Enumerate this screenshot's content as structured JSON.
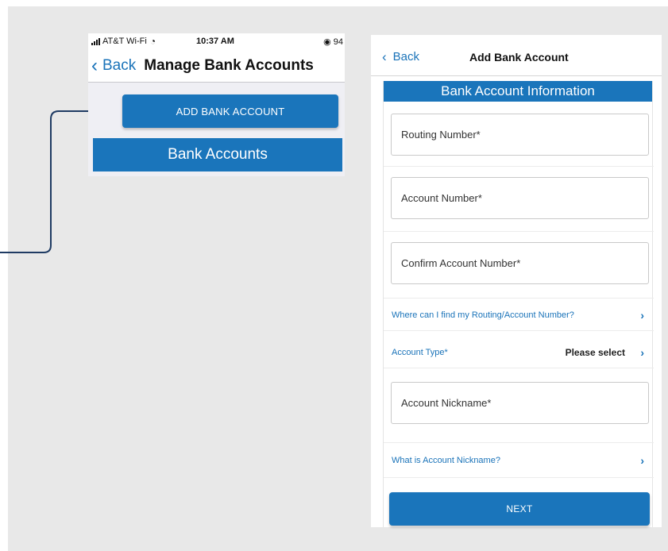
{
  "left_screen": {
    "status_bar": {
      "carrier": "AT&T Wi-Fi",
      "wifi_icon": "wifi-icon",
      "time": "10:37 AM",
      "battery": "94"
    },
    "nav": {
      "back_label": "Back",
      "title": "Manage Bank Accounts"
    },
    "add_button_label": "ADD BANK ACCOUNT",
    "section_header": "Bank Accounts"
  },
  "right_screen": {
    "nav": {
      "back_label": "Back",
      "title": "Add Bank Account"
    },
    "section_header": "Bank Account Information",
    "fields": {
      "routing_placeholder": "Routing Number*",
      "account_placeholder": "Account Number*",
      "confirm_placeholder": "Confirm Account Number*",
      "nickname_placeholder": "Account Nickname*"
    },
    "links": {
      "find_numbers": "Where can I find my Routing/Account Number?",
      "account_type_label": "Account Type*",
      "account_type_value": "Please select",
      "nickname_help": "What is Account Nickname?"
    },
    "next_button_label": "NEXT"
  },
  "colors": {
    "brand_blue": "#1a75bb",
    "link_blue": "#1a73b9",
    "connector": "#1f3b63",
    "background": "#e8e8e8"
  }
}
